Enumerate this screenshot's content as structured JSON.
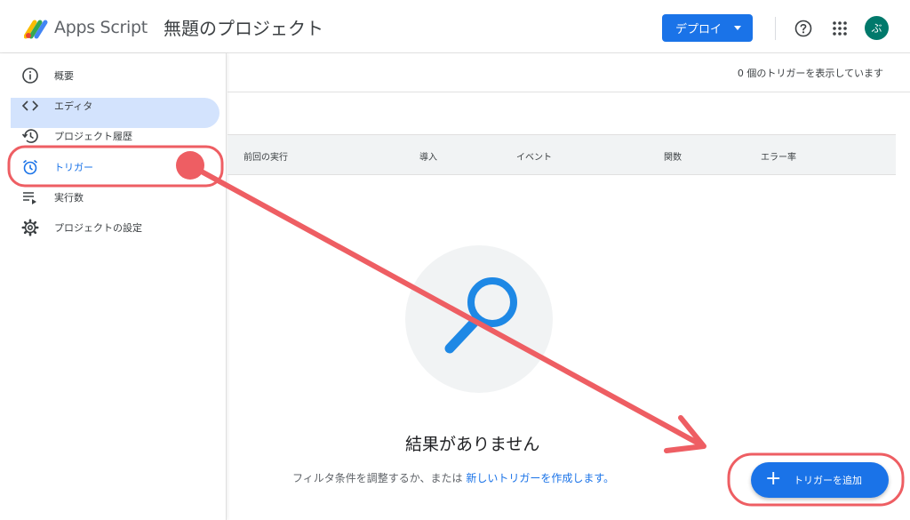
{
  "header": {
    "brand": "Apps Script",
    "project_title": "無題のプロジェクト",
    "deploy_label": "デプロイ",
    "avatar_initial": "ぶ",
    "icons": {
      "help": "help-icon",
      "apps": "apps-grid-icon"
    }
  },
  "sidebar": {
    "items": [
      {
        "label": "概要",
        "icon": "info-icon"
      },
      {
        "label": "エディタ",
        "icon": "code-icon"
      },
      {
        "label": "プロジェクト履歴",
        "icon": "history-icon"
      },
      {
        "label": "トリガー",
        "icon": "alarm-icon",
        "active": true
      },
      {
        "label": "実行数",
        "icon": "executions-icon"
      },
      {
        "label": "プロジェクトの設定",
        "icon": "gear-icon"
      }
    ]
  },
  "main": {
    "count_text": "0 個のトリガーを表示しています",
    "columns": [
      "前回の実行",
      "導入",
      "イベント",
      "関数",
      "エラー率"
    ],
    "empty_title": "結果がありません",
    "empty_desc_prefix": "フィルタ条件を調整するか、または ",
    "empty_desc_link": "新しいトリガーを作成します。",
    "add_trigger_label": "トリガーを追加"
  },
  "colors": {
    "accent": "#1a73e8",
    "active_nav_bg": "#d3e3fd",
    "annotation": "#ee5e63",
    "avatar": "#00796b"
  }
}
